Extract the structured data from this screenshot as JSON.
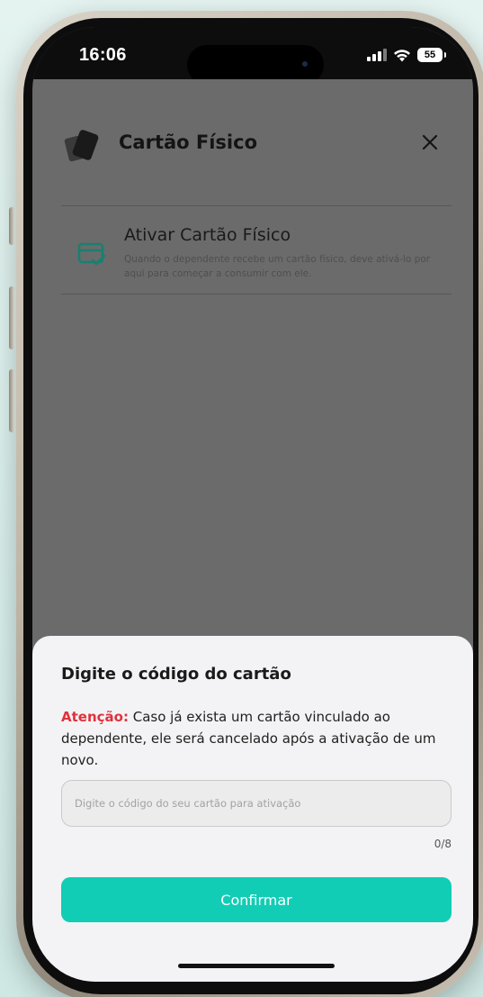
{
  "status_bar": {
    "time": "16:06",
    "battery": "55"
  },
  "header": {
    "title": "Cartão Físico",
    "icon": "cards-icon",
    "close_icon": "close-icon"
  },
  "menu": {
    "items": [
      {
        "title": "Ativar Cartão Físico",
        "description": "Quando o dependente recebe um cartão físico, deve ativá-lo por aqui para começar a consumir com ele.",
        "icon": "card-check-icon"
      }
    ]
  },
  "sheet": {
    "title": "Digite o código do cartão",
    "warning_label": "Atenção:",
    "warning_text": " Caso já exista um cartão vinculado ao dependente, ele será cancelado após a ativação de um novo.",
    "input_value": "",
    "input_placeholder": "Digite o código do seu cartão para ativação",
    "counter": "0/8",
    "confirm_label": "Confirmar"
  },
  "colors": {
    "accent": "#12cdb5",
    "warning": "#e0313d",
    "overlay": "#6b6b6b",
    "icon_teal": "#1a7f6e"
  }
}
